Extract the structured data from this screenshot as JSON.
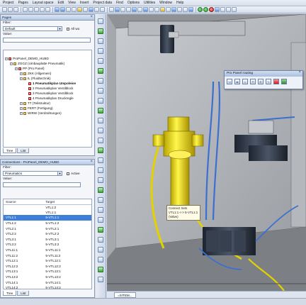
{
  "menu": [
    "Project",
    "Pages",
    "Layout space",
    "Edit",
    "View",
    "Insert",
    "Project data",
    "Find",
    "Options",
    "Utilities",
    "Window",
    "Help"
  ],
  "pages_panel": {
    "title": "Pages",
    "filter_label": "Filter:",
    "filter_value": "Default",
    "all_ws_label": "All wo",
    "values_label": "Value:",
    "tree": [
      {
        "label": "ProPanel_DEMO_HUBD",
        "indent": 0,
        "icon": "red"
      },
      {
        "label": "ZGGZ (Umbauplatte Pneumatik)",
        "indent": 1,
        "icon": "yellow"
      },
      {
        "label": "PP (Pro Panel)",
        "indent": 2,
        "icon": "red"
      },
      {
        "label": "ZKK (Allgemein)",
        "indent": 3,
        "icon": "yellow"
      },
      {
        "label": "IL (Fluidtechnik)",
        "indent": 3,
        "icon": "yellow"
      },
      {
        "label": "1 Pneumatikplan Umpoleise",
        "indent": 4,
        "icon": "red",
        "bold": true
      },
      {
        "label": "2 Pneumatikplan Ventilblock",
        "indent": 4,
        "icon": "red"
      },
      {
        "label": "3 Pneumatikplan Ventilblock",
        "indent": 4,
        "icon": "red"
      },
      {
        "label": "4 Pneumatikplan Druckregle",
        "indent": 4,
        "icon": "red"
      },
      {
        "label": "TT (Teilstruktur)",
        "indent": 3,
        "icon": "yellow"
      },
      {
        "label": "FERT (Fertigung)",
        "indent": 3,
        "icon": "yellow"
      },
      {
        "label": "WIRW (Verdrahtungen)",
        "indent": 3,
        "icon": "yellow"
      }
    ],
    "tabs": [
      "Tree",
      "List"
    ]
  },
  "connections_panel": {
    "title": "Connections - ProPanel_DEMO_HUBD",
    "filter_label": "Filter:",
    "filter_value": "Pneumatics",
    "active_label": "Active",
    "value_label": "Value:",
    "columns": [
      "Source",
      "Target"
    ],
    "rows": [
      [
        "",
        "VTL1:2"
      ],
      [
        "",
        "VTL1:1"
      ],
      [
        "VTL1:1",
        "5-VTL1:1"
      ],
      [
        "VTL1:2",
        "5-VTL1:2"
      ],
      [
        "VTL2:1",
        "5-VTL2:1"
      ],
      [
        "VTL2:2",
        "5-VTL2:2"
      ],
      [
        "VTL3:1",
        "5-VTL3:1"
      ],
      [
        "VTL3:2",
        "5-VTL3:2"
      ],
      [
        "VTL11:1",
        "5-VTL11:1"
      ],
      [
        "VTL11:2",
        "5-VTL11:2"
      ],
      [
        "VTL12:1",
        "5-VTL12:1"
      ],
      [
        "VTL12:2",
        "5-VTL12:2"
      ],
      [
        "VTL13:1",
        "5-VTL13:1"
      ],
      [
        "VTL13:2",
        "5-VTL13:2"
      ],
      [
        "VTL14:1",
        "5-VTL14:1"
      ],
      [
        "VTL14:2",
        "5-VTL14:2"
      ]
    ],
    "selected_row": 2,
    "tabs": [
      "Tree",
      "List"
    ]
  },
  "float_window": {
    "title": "Pro Panel routing"
  },
  "tooltip": {
    "line1": "Connect Sets",
    "line2": "VTL1:1 <-> 5-VTL1:1",
    "line3": "(Valve)"
  },
  "doc_tab": "=SITEM..."
}
